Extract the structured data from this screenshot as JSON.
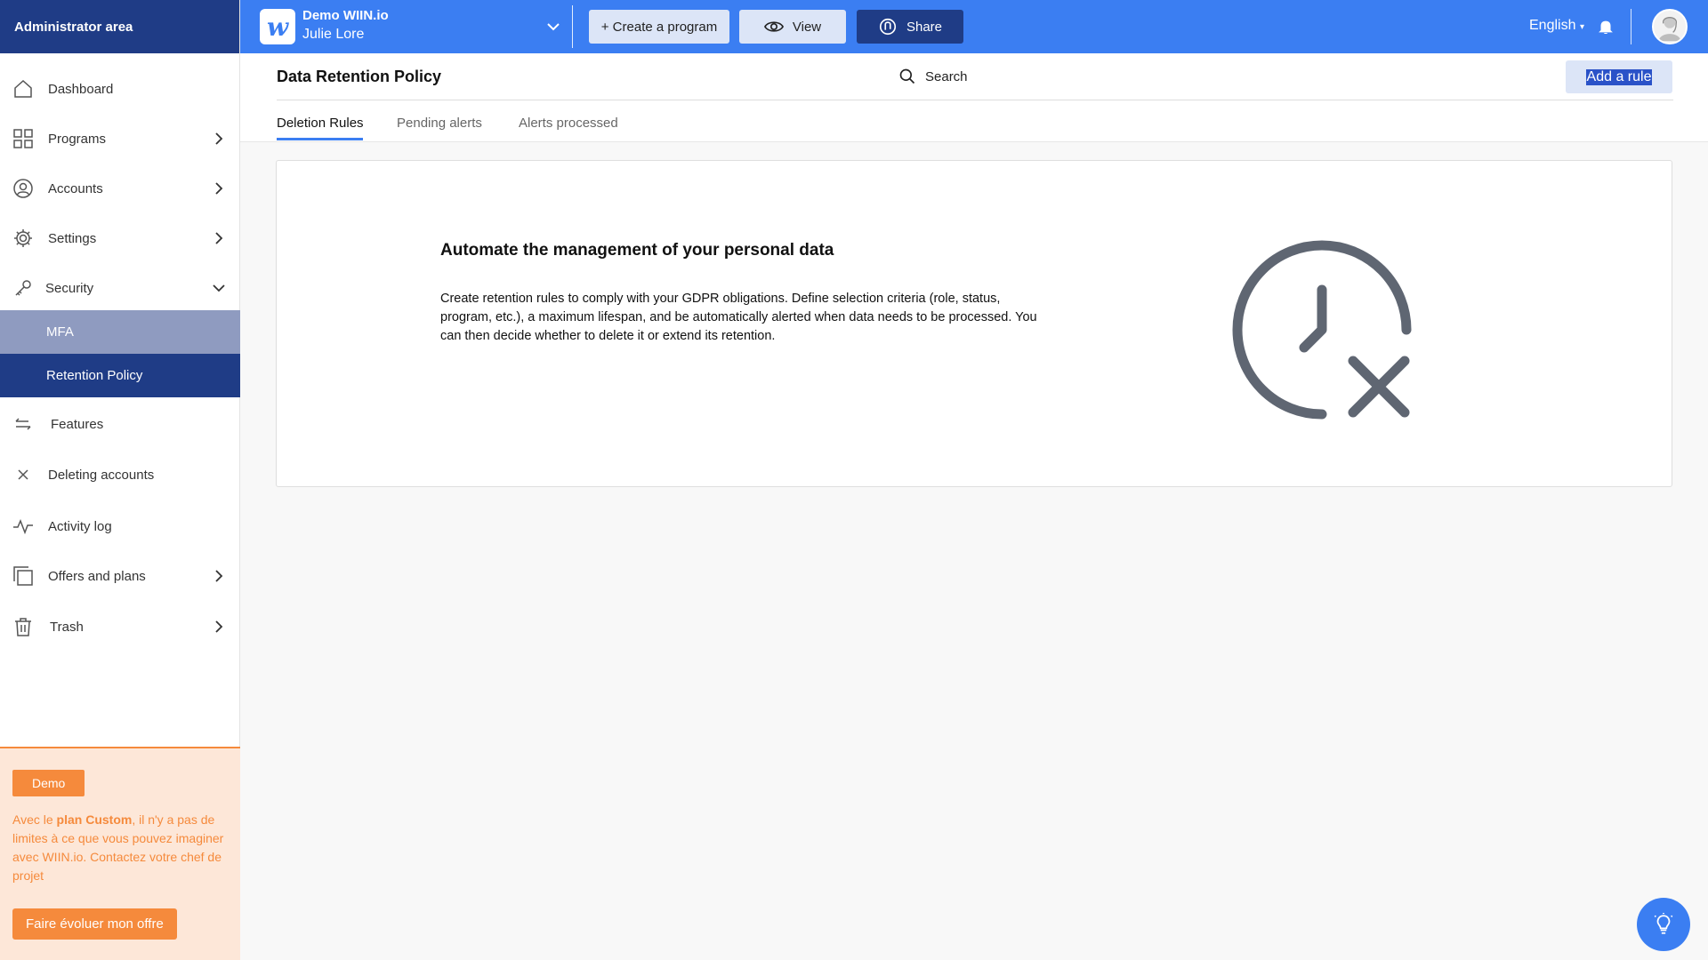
{
  "sidebar": {
    "header": "Administrator area",
    "items": {
      "dashboard": "Dashboard",
      "programs": "Programs",
      "accounts": "Accounts",
      "settings": "Settings",
      "security": "Security",
      "mfa": "MFA",
      "retention": "Retention Policy",
      "features": "Features",
      "deleting": "Deleting accounts",
      "activity": "Activity log",
      "offers": "Offers and plans",
      "trash": "Trash"
    },
    "promo": {
      "badge": "Demo",
      "text_before": "Avec le ",
      "text_bold": "plan Custom",
      "text_after": ", il n'y a pas de limites à ce que vous pouvez imaginer avec WIIN.io. Contactez votre chef de projet",
      "button": "Faire évoluer mon offre"
    }
  },
  "topbar": {
    "org": "Demo WIIN.io",
    "user": "Julie Lore",
    "create_label": "+ Create a program",
    "view_label": "View",
    "share_label": "Share",
    "language": "English"
  },
  "page": {
    "title": "Data Retention Policy",
    "search_label": "Search",
    "add_rule_label": "Add a rule",
    "tabs": {
      "deletion": "Deletion Rules",
      "pending": "Pending alerts",
      "processed": "Alerts processed"
    }
  },
  "card": {
    "title": "Automate the management of your personal data",
    "text": "Create retention rules to comply with your GDPR obligations. Define selection criteria (role, status, program, etc.), a maximum lifespan, and be automatically alerted when data needs to be processed. You can then decide whether to delete it or extend its retention."
  },
  "colors": {
    "primary": "#3b7ef2",
    "navy": "#1f3c86",
    "mfa_bg": "#8f9bc0",
    "promo_orange": "#f58a3c",
    "promo_bg": "#fde7d8",
    "icon_gray": "#5f6672"
  },
  "icons": {
    "logo": "wiin-logo-icon",
    "help": "lightbulb-icon"
  }
}
